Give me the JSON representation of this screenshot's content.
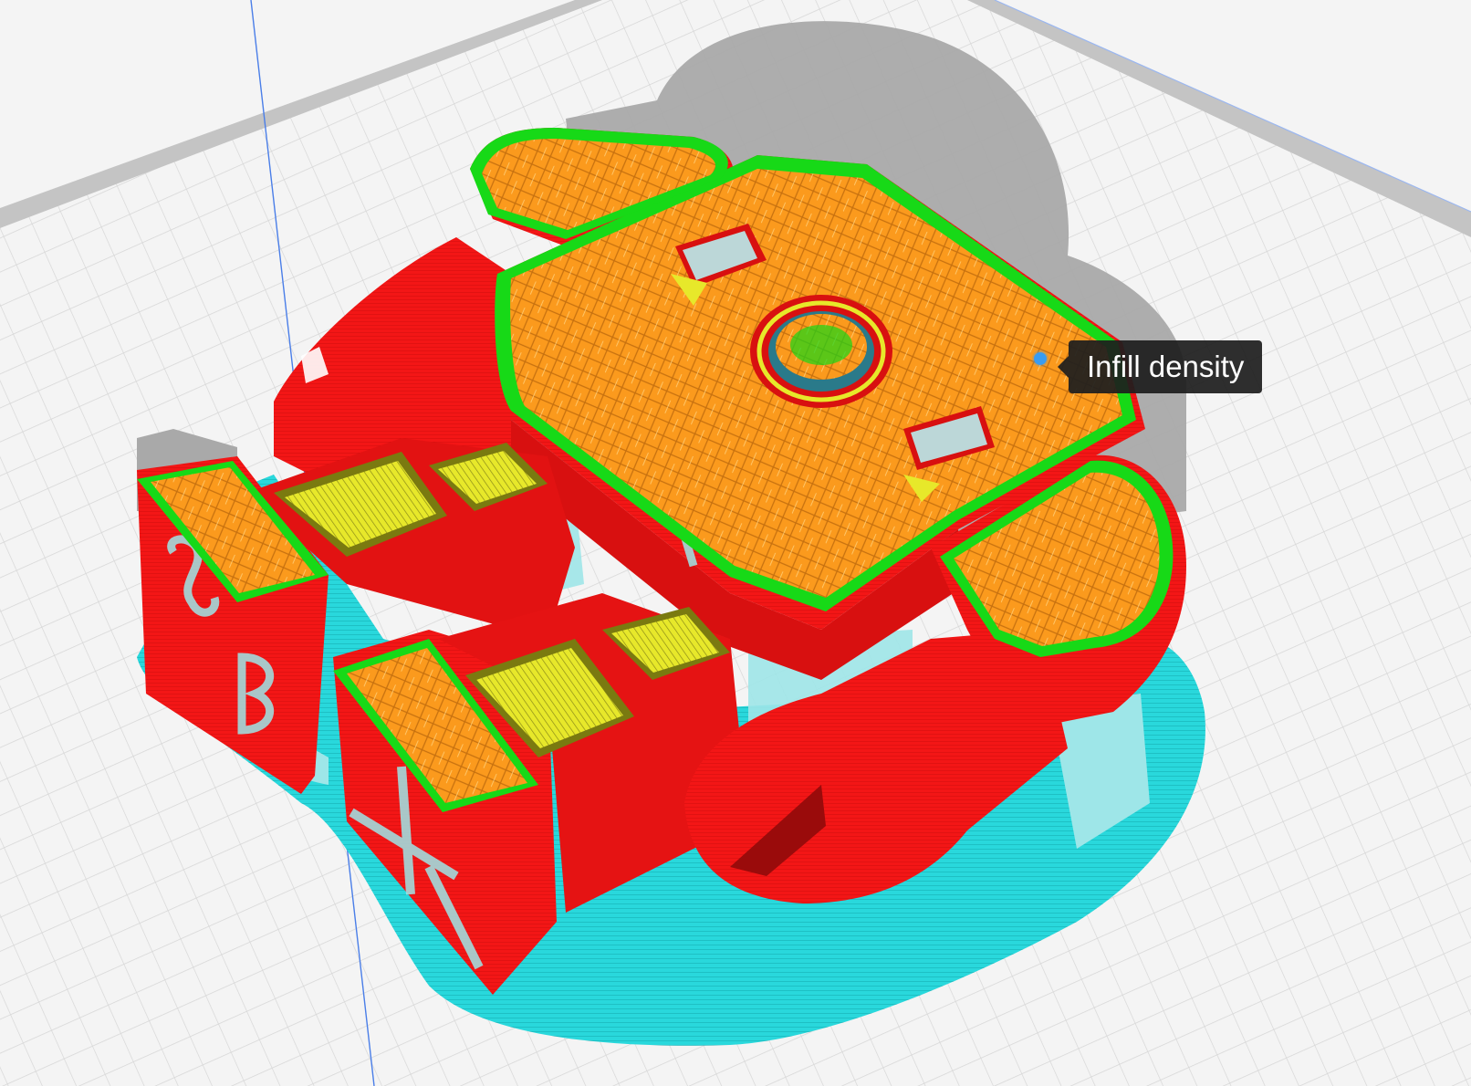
{
  "app": "slicer-layer-preview",
  "tooltip": {
    "text": "Infill density"
  },
  "colors": {
    "build_plate": "#f4f4f4",
    "grid_line": "#d3d3d3",
    "plate_border": "#b9b9b9",
    "shadow": "#a7a7a7",
    "skirt_support": "#29d8dc",
    "support_light": "#9ee6e8",
    "outer_wall": "#f31616",
    "outer_wall_dark": "#c90d0d",
    "infill": "#fb9a1d",
    "inner_wall": "#17d917",
    "top_bottom_skin": "#e7e82a",
    "hint_dot": "#3a9cf0"
  },
  "icons": {
    "hint": "tooltip-hint-dot"
  }
}
